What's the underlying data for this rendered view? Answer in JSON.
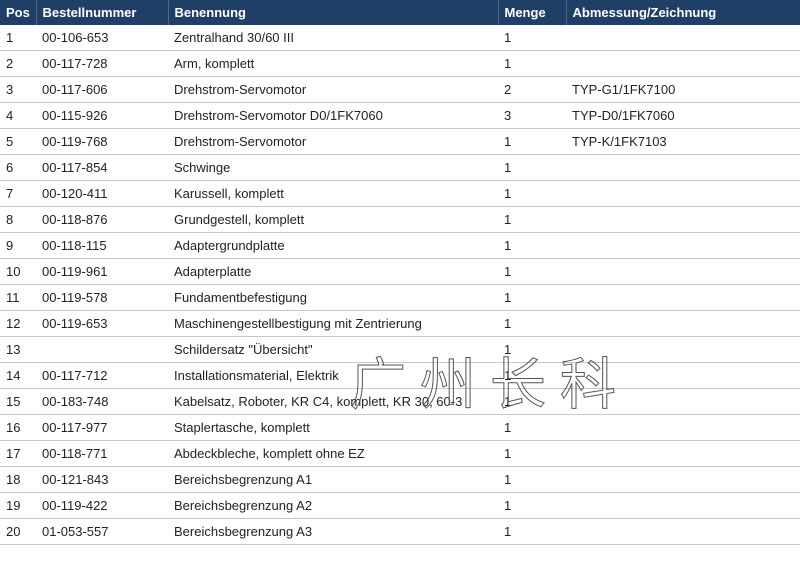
{
  "headers": {
    "pos": "Pos",
    "order": "Bestellnummer",
    "name": "Benennung",
    "qty": "Menge",
    "dim": "Abmessung/Zeichnung"
  },
  "rows": [
    {
      "pos": "1",
      "order": "00-106-653",
      "name": "Zentralhand 30/60 III",
      "qty": "1",
      "dim": ""
    },
    {
      "pos": "2",
      "order": "00-117-728",
      "name": "Arm, komplett",
      "qty": "1",
      "dim": ""
    },
    {
      "pos": "3",
      "order": "00-117-606",
      "name": "Drehstrom-Servomotor",
      "qty": "2",
      "dim": "TYP-G1/1FK7100"
    },
    {
      "pos": "4",
      "order": "00-115-926",
      "name": "Drehstrom-Servomotor D0/1FK7060",
      "qty": "3",
      "dim": "TYP-D0/1FK7060"
    },
    {
      "pos": "5",
      "order": "00-119-768",
      "name": "Drehstrom-Servomotor",
      "qty": "1",
      "dim": "TYP-K/1FK7103"
    },
    {
      "pos": "6",
      "order": "00-117-854",
      "name": "Schwinge",
      "qty": "1",
      "dim": ""
    },
    {
      "pos": "7",
      "order": "00-120-411",
      "name": "Karussell, komplett",
      "qty": "1",
      "dim": ""
    },
    {
      "pos": "8",
      "order": "00-118-876",
      "name": "Grundgestell, komplett",
      "qty": "1",
      "dim": ""
    },
    {
      "pos": "9",
      "order": "00-118-115",
      "name": "Adaptergrundplatte",
      "qty": "1",
      "dim": ""
    },
    {
      "pos": "10",
      "order": "00-119-961",
      "name": "Adapterplatte",
      "qty": "1",
      "dim": ""
    },
    {
      "pos": "11",
      "order": "00-119-578",
      "name": "Fundamentbefestigung",
      "qty": "1",
      "dim": ""
    },
    {
      "pos": "12",
      "order": "00-119-653",
      "name": "Maschinengestellbestigung mit Zentrierung",
      "qty": "1",
      "dim": ""
    },
    {
      "pos": "13",
      "order": "",
      "name": "Schildersatz \"Übersicht\"",
      "qty": "1",
      "dim": ""
    },
    {
      "pos": "14",
      "order": "00-117-712",
      "name": "Installationsmaterial, Elektrik",
      "qty": "1",
      "dim": ""
    },
    {
      "pos": "15",
      "order": "00-183-748",
      "name": "Kabelsatz, Roboter, KR C4, komplett, KR 30, 60-3",
      "qty": "1",
      "dim": ""
    },
    {
      "pos": "16",
      "order": "00-117-977",
      "name": "Staplertasche, komplett",
      "qty": "1",
      "dim": ""
    },
    {
      "pos": "17",
      "order": "00-118-771",
      "name": "Abdeckbleche, komplett ohne EZ",
      "qty": "1",
      "dim": ""
    },
    {
      "pos": "18",
      "order": "00-121-843",
      "name": "Bereichsbegrenzung A1",
      "qty": "1",
      "dim": ""
    },
    {
      "pos": "19",
      "order": "00-119-422",
      "name": "Bereichsbegrenzung A2",
      "qty": "1",
      "dim": ""
    },
    {
      "pos": "20",
      "order": "01-053-557",
      "name": "Bereichsbegrenzung A3",
      "qty": "1",
      "dim": ""
    }
  ],
  "watermark": "广州长科"
}
